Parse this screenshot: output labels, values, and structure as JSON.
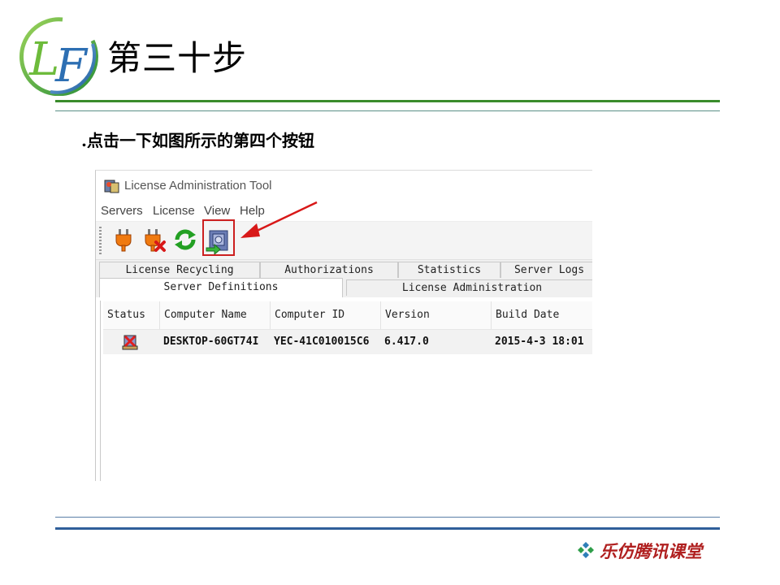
{
  "slide": {
    "title": "第三十步",
    "instruction": ".点击一下如图所示的第四个按钮",
    "footer": "乐仿腾讯课堂",
    "colors": {
      "green_rule": "#3a8c2b",
      "blue_rule": "#2f5f9a",
      "highlight": "#cc1f1f",
      "footer": "#b02020"
    }
  },
  "app": {
    "title": "License Administration Tool",
    "menu": [
      "Servers",
      "License",
      "View",
      "Help"
    ],
    "toolbar": [
      {
        "name": "connect-plug-icon"
      },
      {
        "name": "disconnect-plug-icon"
      },
      {
        "name": "refresh-icon"
      },
      {
        "name": "import-license-icon",
        "highlighted": true
      }
    ],
    "tabs": {
      "row_back": [
        "License Recycling",
        "Authorizations",
        "Statistics",
        "Server Logs"
      ],
      "row_front": [
        "Server Definitions",
        "License Administration"
      ],
      "active": "Server Definitions"
    },
    "grid": {
      "columns": [
        "Status",
        "Computer Name",
        "Computer ID",
        "Version",
        "Build Date"
      ],
      "rows": [
        {
          "status_icon": "server-error-icon",
          "computer_name": "DESKTOP-60GT74I",
          "computer_id": "YEC-41C010015C6",
          "version": "6.417.0",
          "build_date": "2015-4-3 18:01"
        }
      ]
    }
  }
}
